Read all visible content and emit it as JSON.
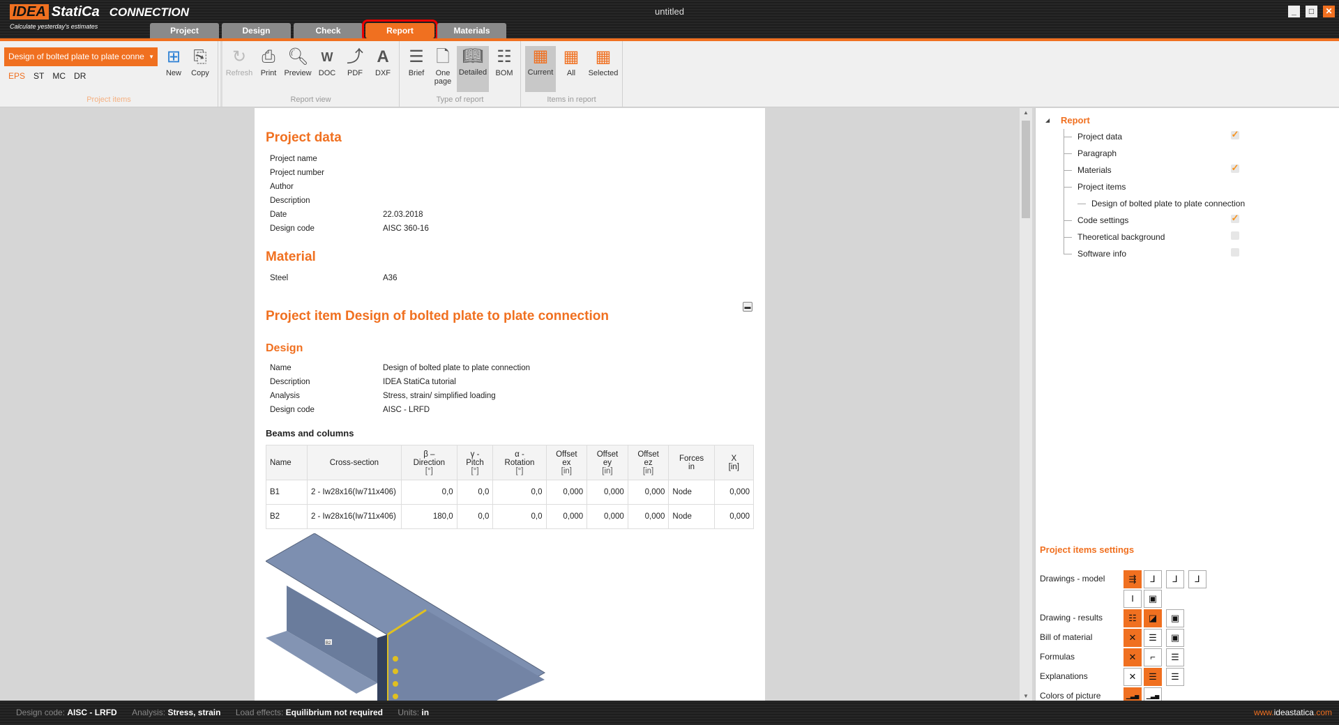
{
  "app": {
    "logo_brand": "IDEA",
    "logo_name": "StatiCa",
    "logo_product": "CONNECTION",
    "tagline": "Calculate yesterday's estimates",
    "window_title": "untitled"
  },
  "tabs": [
    {
      "label": "Project"
    },
    {
      "label": "Design"
    },
    {
      "label": "Check"
    },
    {
      "label": "Report"
    },
    {
      "label": "Materials"
    }
  ],
  "ribbon": {
    "project_items": {
      "selected": "Design of bolted plate to plate conne",
      "modes": [
        "EPS",
        "ST",
        "MC",
        "DR"
      ],
      "new": "New",
      "copy": "Copy",
      "label": "Project items"
    },
    "report_view": {
      "buttons": [
        "Refresh",
        "Print",
        "Preview",
        "DOC",
        "PDF",
        "DXF"
      ],
      "label": "Report view"
    },
    "type_of_report": {
      "brief": "Brief",
      "one": "One",
      "page": "page",
      "detailed": "Detailed",
      "bom": "BOM",
      "label": "Type of report"
    },
    "items_in_report": {
      "buttons": [
        "Current",
        "All",
        "Selected"
      ],
      "label": "Items in report"
    }
  },
  "report": {
    "project_data_title": "Project data",
    "project_data": [
      [
        "Project name",
        ""
      ],
      [
        "Project number",
        ""
      ],
      [
        "Author",
        ""
      ],
      [
        "Description",
        ""
      ],
      [
        "Date",
        "22.03.2018"
      ],
      [
        "Design code",
        "AISC 360-16"
      ]
    ],
    "material_title": "Material",
    "material": [
      [
        "Steel",
        "A36"
      ]
    ],
    "item_title": "Project item Design of bolted plate to plate connection",
    "design_title": "Design",
    "design": [
      [
        "Name",
        "Design of bolted plate to plate connection"
      ],
      [
        "Description",
        "IDEA StatiCa tutorial"
      ],
      [
        "Analysis",
        "Stress, strain/ simplified loading"
      ],
      [
        "Design code",
        "AISC - LRFD"
      ]
    ],
    "beams_title": "Beams and columns",
    "table": {
      "headers": [
        [
          "Name"
        ],
        [
          "Cross-section"
        ],
        [
          "β –",
          "Direction",
          "[°]"
        ],
        [
          "γ -",
          "Pitch",
          "[°]"
        ],
        [
          "α -",
          "Rotation",
          "[°]"
        ],
        [
          "Offset",
          "ex",
          "[in]"
        ],
        [
          "Offset",
          "ey",
          "[in]"
        ],
        [
          "Offset",
          "ez",
          "[in]"
        ],
        [
          "Forces",
          "in"
        ],
        [
          "X",
          "[in]"
        ]
      ],
      "rows": [
        [
          "B1",
          "2 - Iw28x16(Iw711x406)",
          "0,0",
          "0,0",
          "0,0",
          "0,000",
          "0,000",
          "0,000",
          "Node",
          "0,000"
        ],
        [
          "B2",
          "2 - Iw28x16(Iw711x406)",
          "180,0",
          "0,0",
          "0,0",
          "0,000",
          "0,000",
          "0,000",
          "Node",
          "0,000"
        ]
      ]
    },
    "image_label": "B2"
  },
  "tree": {
    "root": "Report",
    "items": [
      {
        "label": "Project data",
        "checked": true
      },
      {
        "label": "Paragraph"
      },
      {
        "label": "Materials",
        "checked": true
      },
      {
        "label": "Project items"
      },
      {
        "label": "Design of bolted plate to plate connection",
        "child": true
      },
      {
        "label": "Code settings",
        "checked": true
      },
      {
        "label": "Theoretical background",
        "checked": false
      },
      {
        "label": "Software info",
        "checked": false
      }
    ]
  },
  "settings": {
    "title": "Project items settings",
    "rows": [
      "Drawings - model",
      "Drawing - results",
      "Bill of material",
      "Formulas",
      "Explanations",
      "Colors of picture"
    ]
  },
  "status": {
    "code_label": "Design code:",
    "code": "AISC - LRFD",
    "analysis_label": "Analysis:",
    "analysis": "Stress, strain",
    "load_label": "Load effects:",
    "load": "Equilibrium not required",
    "units_label": "Units:",
    "units": "in",
    "url_a": "www.",
    "url_b": "ideastatica",
    ".com": ".com",
    "url_c": ".com"
  },
  "colors": {
    "accent": "#f07020"
  }
}
